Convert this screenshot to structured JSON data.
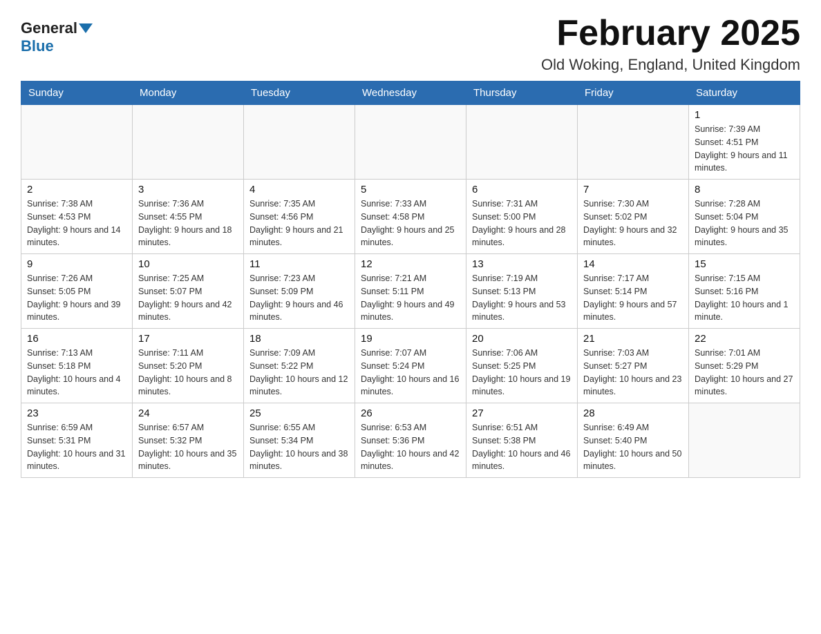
{
  "header": {
    "logo_general": "General",
    "logo_blue": "Blue",
    "title": "February 2025",
    "location": "Old Woking, England, United Kingdom"
  },
  "days_of_week": [
    "Sunday",
    "Monday",
    "Tuesday",
    "Wednesday",
    "Thursday",
    "Friday",
    "Saturday"
  ],
  "weeks": [
    [
      {
        "day": "",
        "info": ""
      },
      {
        "day": "",
        "info": ""
      },
      {
        "day": "",
        "info": ""
      },
      {
        "day": "",
        "info": ""
      },
      {
        "day": "",
        "info": ""
      },
      {
        "day": "",
        "info": ""
      },
      {
        "day": "1",
        "info": "Sunrise: 7:39 AM\nSunset: 4:51 PM\nDaylight: 9 hours and 11 minutes."
      }
    ],
    [
      {
        "day": "2",
        "info": "Sunrise: 7:38 AM\nSunset: 4:53 PM\nDaylight: 9 hours and 14 minutes."
      },
      {
        "day": "3",
        "info": "Sunrise: 7:36 AM\nSunset: 4:55 PM\nDaylight: 9 hours and 18 minutes."
      },
      {
        "day": "4",
        "info": "Sunrise: 7:35 AM\nSunset: 4:56 PM\nDaylight: 9 hours and 21 minutes."
      },
      {
        "day": "5",
        "info": "Sunrise: 7:33 AM\nSunset: 4:58 PM\nDaylight: 9 hours and 25 minutes."
      },
      {
        "day": "6",
        "info": "Sunrise: 7:31 AM\nSunset: 5:00 PM\nDaylight: 9 hours and 28 minutes."
      },
      {
        "day": "7",
        "info": "Sunrise: 7:30 AM\nSunset: 5:02 PM\nDaylight: 9 hours and 32 minutes."
      },
      {
        "day": "8",
        "info": "Sunrise: 7:28 AM\nSunset: 5:04 PM\nDaylight: 9 hours and 35 minutes."
      }
    ],
    [
      {
        "day": "9",
        "info": "Sunrise: 7:26 AM\nSunset: 5:05 PM\nDaylight: 9 hours and 39 minutes."
      },
      {
        "day": "10",
        "info": "Sunrise: 7:25 AM\nSunset: 5:07 PM\nDaylight: 9 hours and 42 minutes."
      },
      {
        "day": "11",
        "info": "Sunrise: 7:23 AM\nSunset: 5:09 PM\nDaylight: 9 hours and 46 minutes."
      },
      {
        "day": "12",
        "info": "Sunrise: 7:21 AM\nSunset: 5:11 PM\nDaylight: 9 hours and 49 minutes."
      },
      {
        "day": "13",
        "info": "Sunrise: 7:19 AM\nSunset: 5:13 PM\nDaylight: 9 hours and 53 minutes."
      },
      {
        "day": "14",
        "info": "Sunrise: 7:17 AM\nSunset: 5:14 PM\nDaylight: 9 hours and 57 minutes."
      },
      {
        "day": "15",
        "info": "Sunrise: 7:15 AM\nSunset: 5:16 PM\nDaylight: 10 hours and 1 minute."
      }
    ],
    [
      {
        "day": "16",
        "info": "Sunrise: 7:13 AM\nSunset: 5:18 PM\nDaylight: 10 hours and 4 minutes."
      },
      {
        "day": "17",
        "info": "Sunrise: 7:11 AM\nSunset: 5:20 PM\nDaylight: 10 hours and 8 minutes."
      },
      {
        "day": "18",
        "info": "Sunrise: 7:09 AM\nSunset: 5:22 PM\nDaylight: 10 hours and 12 minutes."
      },
      {
        "day": "19",
        "info": "Sunrise: 7:07 AM\nSunset: 5:24 PM\nDaylight: 10 hours and 16 minutes."
      },
      {
        "day": "20",
        "info": "Sunrise: 7:06 AM\nSunset: 5:25 PM\nDaylight: 10 hours and 19 minutes."
      },
      {
        "day": "21",
        "info": "Sunrise: 7:03 AM\nSunset: 5:27 PM\nDaylight: 10 hours and 23 minutes."
      },
      {
        "day": "22",
        "info": "Sunrise: 7:01 AM\nSunset: 5:29 PM\nDaylight: 10 hours and 27 minutes."
      }
    ],
    [
      {
        "day": "23",
        "info": "Sunrise: 6:59 AM\nSunset: 5:31 PM\nDaylight: 10 hours and 31 minutes."
      },
      {
        "day": "24",
        "info": "Sunrise: 6:57 AM\nSunset: 5:32 PM\nDaylight: 10 hours and 35 minutes."
      },
      {
        "day": "25",
        "info": "Sunrise: 6:55 AM\nSunset: 5:34 PM\nDaylight: 10 hours and 38 minutes."
      },
      {
        "day": "26",
        "info": "Sunrise: 6:53 AM\nSunset: 5:36 PM\nDaylight: 10 hours and 42 minutes."
      },
      {
        "day": "27",
        "info": "Sunrise: 6:51 AM\nSunset: 5:38 PM\nDaylight: 10 hours and 46 minutes."
      },
      {
        "day": "28",
        "info": "Sunrise: 6:49 AM\nSunset: 5:40 PM\nDaylight: 10 hours and 50 minutes."
      },
      {
        "day": "",
        "info": ""
      }
    ]
  ]
}
